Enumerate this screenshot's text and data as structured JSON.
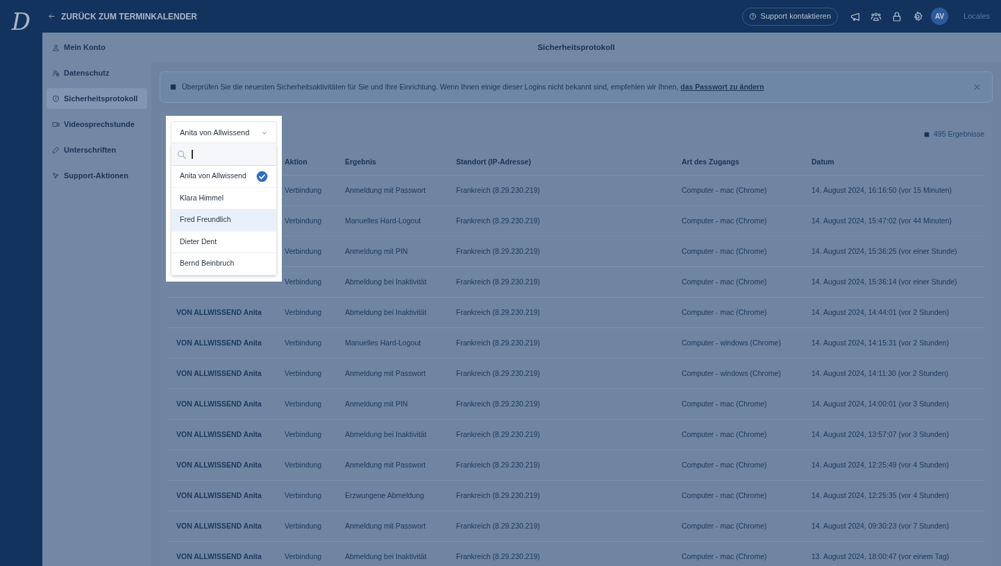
{
  "logo": "D",
  "top_bar": {
    "back_link": "ZURÜCK ZUM TERMINKALENDER",
    "support_button": "Support kontaktieren",
    "avatar": "AV",
    "locale": "Locales"
  },
  "sidebar": {
    "items": [
      {
        "label": "Mein Konto",
        "selected": false
      },
      {
        "label": "Datenschutz",
        "selected": false
      },
      {
        "label": "Sicherheitsprotokoll",
        "selected": true
      },
      {
        "label": "Videosprechstunde",
        "selected": false
      },
      {
        "label": "Unterschriften",
        "selected": false
      },
      {
        "label": "Support-Aktionen",
        "selected": false
      }
    ]
  },
  "page_title": "Sicherheitsprotokoll",
  "banner": {
    "text": "Überprüfen Sie die neuesten Sicherheitsaktivitäten für Sie und Ihre Einrichtung. Wenn Ihnen einige dieser Logins nicht bekannt sind, empfehlen wir Ihnen,",
    "link": "das Passwort zu ändern"
  },
  "results_count": "495 Ergebnisse",
  "user_filter": {
    "value": "Anita von Allwissend",
    "options": [
      {
        "label": "Anita von Allwissend",
        "selected": true,
        "highlighted": false
      },
      {
        "label": "Klara Himmel",
        "selected": false,
        "highlighted": false
      },
      {
        "label": "Fred Freundlich",
        "selected": false,
        "highlighted": true
      },
      {
        "label": "Dieter Dent",
        "selected": false,
        "highlighted": false
      },
      {
        "label": "Bernd Beinbruch",
        "selected": false,
        "highlighted": false
      }
    ]
  },
  "table": {
    "columns": [
      "Aktion",
      "Ergebnis",
      "Standort (IP-Adresse)",
      "Art des Zugangs",
      "Datum"
    ],
    "rows": [
      {
        "action": "Verbindung",
        "result": "Anmeldung mit Passwort",
        "location": "Frankreich (8.29.230.219)",
        "access": "Computer - mac (Chrome)",
        "date": "14. August 2024, 16:16:50 (vor 15 Minuten)"
      },
      {
        "action": "Verbindung",
        "result": "Manuelles Hard-Logout",
        "location": "Frankreich (8.29.230.219)",
        "access": "Computer - mac (Chrome)",
        "date": "14. August 2024, 15:47:02 (vor 44 Minuten)"
      },
      {
        "action": "Verbindung",
        "result": "Anmeldung mit PIN",
        "location": "Frankreich (8.29.230.219)",
        "access": "Computer - mac (Chrome)",
        "date": "14. August 2024, 15:36:25 (vor einer Stunde)"
      },
      {
        "action": "Verbindung",
        "result": "Abmeldung bei Inaktivität",
        "location": "Frankreich (8.29.230.219)",
        "access": "Computer - mac (Chrome)",
        "date": "14. August 2024, 15:36:14 (vor einer Stunde)"
      },
      {
        "user": "VON ALLWISSEND Anita",
        "action": "Verbindung",
        "result": "Abmeldung bei Inaktivität",
        "location": "Frankreich (8.29.230.219)",
        "access": "Computer - mac (Chrome)",
        "date": "14. August 2024, 14:44:01 (vor 2 Stunden)"
      },
      {
        "user": "VON ALLWISSEND Anita",
        "action": "Verbindung",
        "result": "Manuelles Hard-Logout",
        "location": "Frankreich (8.29.230.219)",
        "access": "Computer - windows (Chrome)",
        "date": "14. August 2024, 14:15:31 (vor 2 Stunden)"
      },
      {
        "user": "VON ALLWISSEND Anita",
        "action": "Verbindung",
        "result": "Anmeldung mit Passwort",
        "location": "Frankreich (8.29.230.219)",
        "access": "Computer - windows (Chrome)",
        "date": "14. August 2024, 14:11:30 (vor 2 Stunden)"
      },
      {
        "user": "VON ALLWISSEND Anita",
        "action": "Verbindung",
        "result": "Anmeldung mit PIN",
        "location": "Frankreich (8.29.230.219)",
        "access": "Computer - mac (Chrome)",
        "date": "14. August 2024, 14:00:01 (vor 3 Stunden)"
      },
      {
        "user": "VON ALLWISSEND Anita",
        "action": "Verbindung",
        "result": "Abmeldung bei Inaktivität",
        "location": "Frankreich (8.29.230.219)",
        "access": "Computer - mac (Chrome)",
        "date": "14. August 2024, 13:57:07 (vor 3 Stunden)"
      },
      {
        "user": "VON ALLWISSEND Anita",
        "action": "Verbindung",
        "result": "Anmeldung mit Passwort",
        "location": "Frankreich (8.29.230.219)",
        "access": "Computer - mac (Chrome)",
        "date": "14. August 2024, 12:25:49 (vor 4 Stunden)"
      },
      {
        "user": "VON ALLWISSEND Anita",
        "action": "Verbindung",
        "result": "Erzwungene Abmeldung",
        "location": "Frankreich (8.29.230.219)",
        "access": "Computer - mac (Chrome)",
        "date": "14. August 2024, 12:25:35 (vor 4 Stunden)"
      },
      {
        "user": "VON ALLWISSEND Anita",
        "action": "Verbindung",
        "result": "Anmeldung mit Passwort",
        "location": "Frankreich (8.29.230.219)",
        "access": "Computer - mac (Chrome)",
        "date": "14. August 2024, 09:30:23 (vor 7 Stunden)"
      },
      {
        "user": "VON ALLWISSEND Anita",
        "action": "Verbindung",
        "result": "Abmeldung bei Inaktivität",
        "location": "Frankreich (8.29.230.219)",
        "access": "Computer - mac (Chrome)",
        "date": "13. August 2024, 18:00:47 (vor einem Tag)"
      }
    ]
  }
}
